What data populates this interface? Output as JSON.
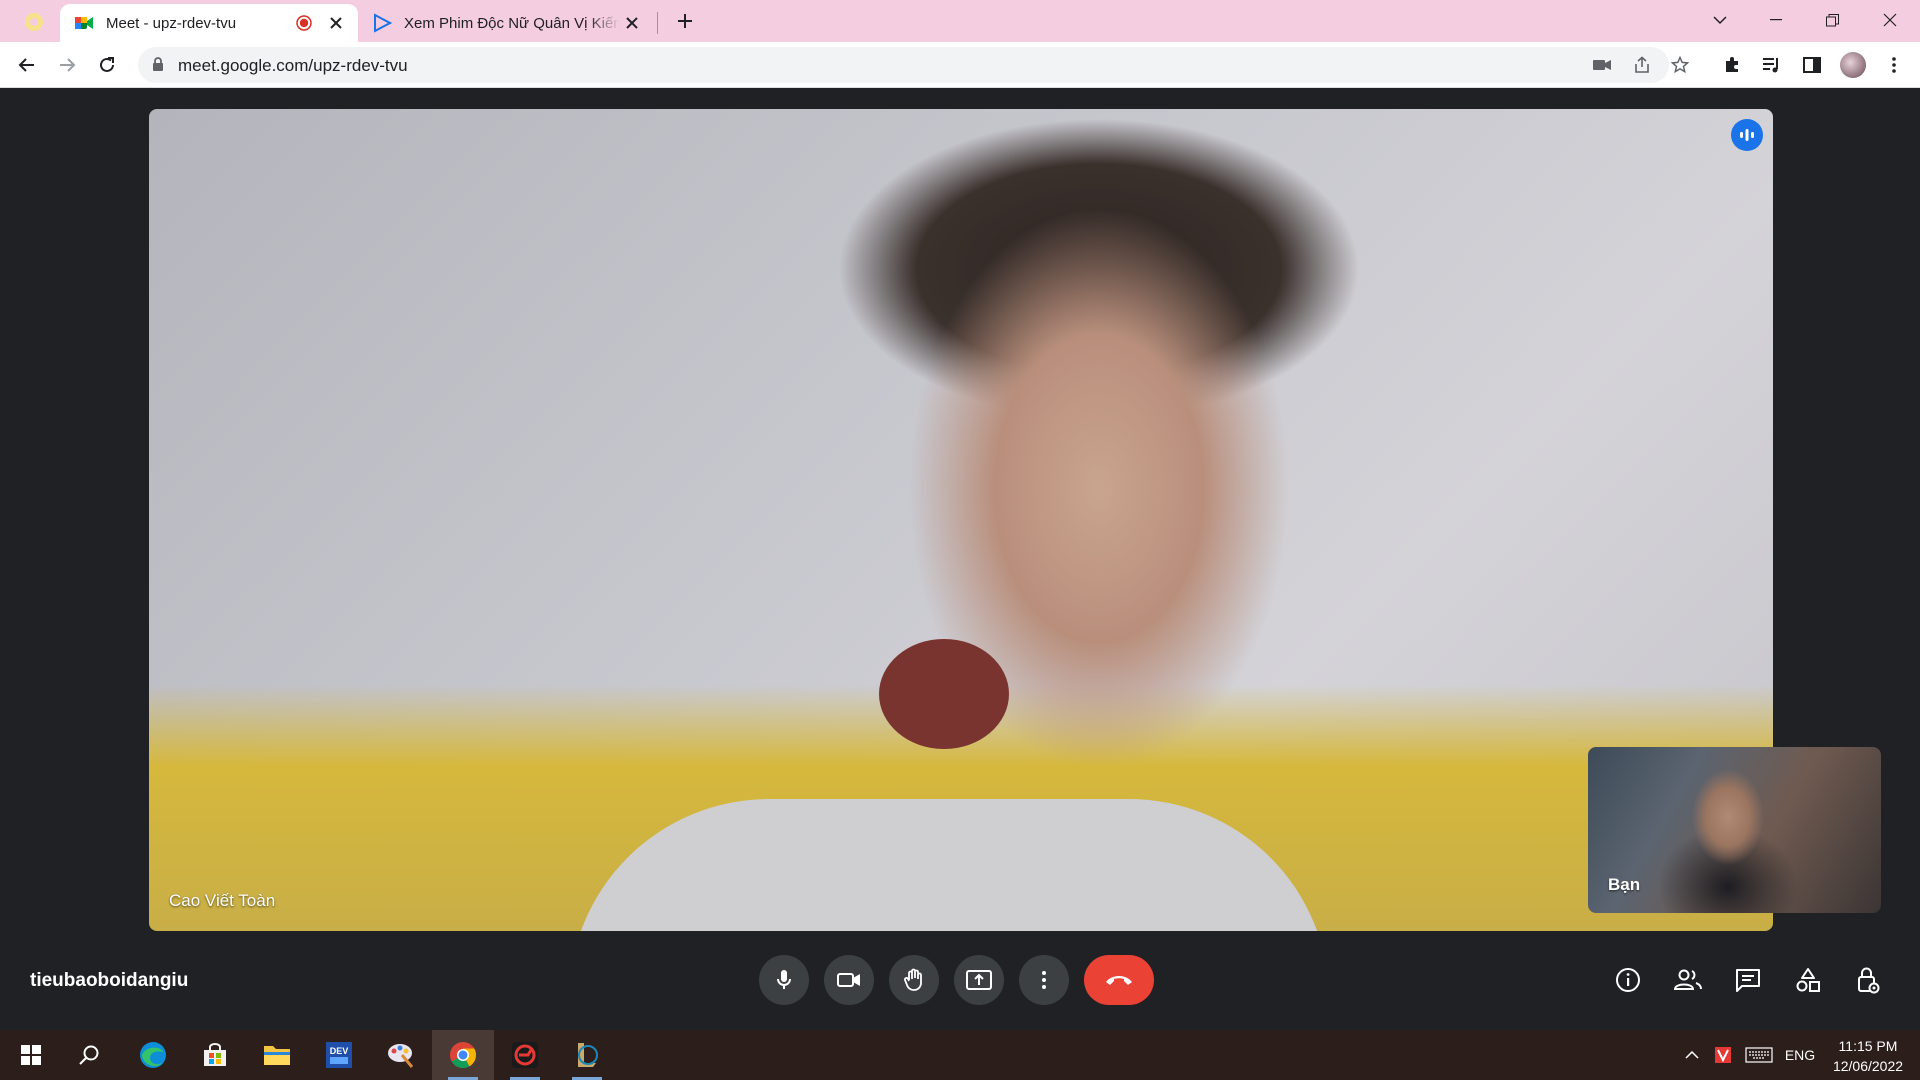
{
  "browser": {
    "tabs": [
      {
        "title": "Meet - upz-rdev-tvu",
        "active": true,
        "recording": true
      },
      {
        "title": "Xem Phim Độc Nữ Quân Vị Kiến",
        "active": false
      }
    ],
    "url": "meet.google.com/upz-rdev-tvu",
    "accent": "#f4cde0"
  },
  "meet": {
    "main_participant": "Cao Viết Toàn",
    "self_label": "Bạn",
    "meeting_code": "tieubaoboidangiu",
    "participants_count": "2",
    "controls": [
      "mic-icon",
      "camera-icon",
      "raise-hand-icon",
      "present-icon",
      "more-options-icon",
      "hang-up-icon"
    ],
    "side_actions": [
      "info-icon",
      "people-icon",
      "chat-icon",
      "activities-icon",
      "host-controls-icon"
    ],
    "hangup_color": "#ea4335"
  },
  "taskbar": {
    "language": "ENG",
    "time": "11:15 PM",
    "date": "12/06/2022",
    "apps": [
      "start-icon",
      "search-icon",
      "edge-icon",
      "store-icon",
      "file-explorer-icon",
      "devcpp-icon",
      "paint-icon",
      "chrome-icon",
      "garena-icon",
      "league-icon"
    ]
  }
}
